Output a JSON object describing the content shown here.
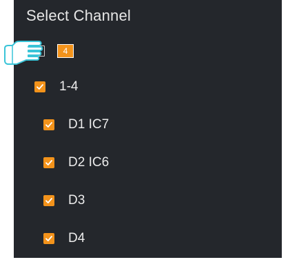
{
  "panel": {
    "title": "Select Channel",
    "selected_count": "4",
    "groups": [
      {
        "label": "1-4",
        "checked": true,
        "channels": [
          {
            "label": "D1 IC7",
            "checked": true
          },
          {
            "label": "D2 IC6",
            "checked": true
          },
          {
            "label": "D3",
            "checked": true
          },
          {
            "label": "D4",
            "checked": true
          }
        ]
      }
    ]
  },
  "colors": {
    "panel_bg": "#24272c",
    "accent": "#f3931b",
    "text": "#ececec"
  },
  "icons": {
    "pointer": "pointing-hand-icon",
    "checkbox": "checkmark-icon"
  }
}
